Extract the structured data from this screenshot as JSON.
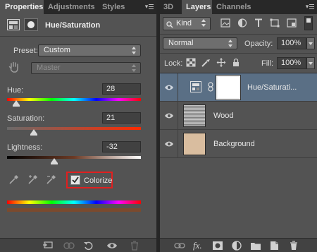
{
  "properties_panel": {
    "tabs": [
      {
        "label": "Properties",
        "active": true
      },
      {
        "label": "Adjustments",
        "active": false
      },
      {
        "label": "Styles",
        "active": false
      }
    ],
    "header_title": "Hue/Saturation",
    "preset_label": "Preset:",
    "preset_value": "Custom",
    "channel_value": "Master",
    "sliders": [
      {
        "label": "Hue:",
        "value": "28",
        "position": 0.07
      },
      {
        "label": "Saturation:",
        "value": "21",
        "position": 0.2
      },
      {
        "label": "Lightness:",
        "value": "-32",
        "position": 0.35
      }
    ],
    "colorize_label": "Colorize",
    "colorize_checked": true,
    "highlight_color": "#e02020"
  },
  "layers_panel": {
    "tabs": [
      {
        "label": "3D",
        "active": false
      },
      {
        "label": "Layers",
        "active": true
      },
      {
        "label": "Channels",
        "active": false
      }
    ],
    "filter_kind": "Kind",
    "blend_mode": "Normal",
    "opacity_label": "Opacity:",
    "opacity_value": "100%",
    "lock_label": "Lock:",
    "fill_label": "Fill:",
    "fill_value": "100%",
    "layers": [
      {
        "name": "Hue/Saturati...",
        "type": "adjustment",
        "selected": true
      },
      {
        "name": "Wood",
        "type": "pixel",
        "selected": false
      },
      {
        "name": "Background",
        "type": "pixel",
        "selected": false
      }
    ],
    "background_swatch": "#d9bd9f",
    "selection_color": "#5a6f85"
  }
}
